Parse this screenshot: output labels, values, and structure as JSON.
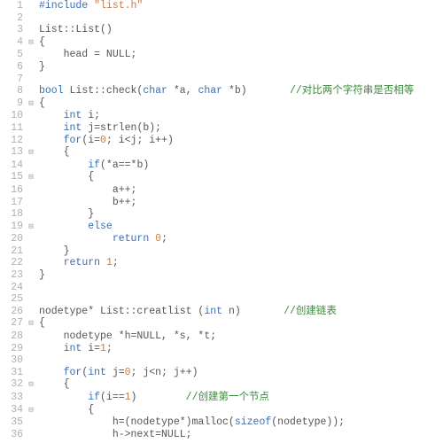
{
  "code": {
    "lines": [
      {
        "n": "1",
        "fold": "",
        "html": "<span class='kw'>#include</span> <span class='str'>\"list.h\"</span>"
      },
      {
        "n": "2",
        "fold": "",
        "html": ""
      },
      {
        "n": "3",
        "fold": "",
        "html": "List::List()"
      },
      {
        "n": "4",
        "fold": "⊟",
        "html": "{"
      },
      {
        "n": "5",
        "fold": "",
        "html": "    head = NULL;"
      },
      {
        "n": "6",
        "fold": "",
        "html": "}"
      },
      {
        "n": "7",
        "fold": "",
        "html": ""
      },
      {
        "n": "8",
        "fold": "",
        "html": "<span class='kw'>bool</span> List::check(<span class='kw'>char</span> *a, <span class='kw'>char</span> *b)       <span class='cmt'>//对比两个字符串是否相等</span>"
      },
      {
        "n": "9",
        "fold": "⊟",
        "html": "{"
      },
      {
        "n": "10",
        "fold": "",
        "html": "    <span class='kw'>int</span> i;"
      },
      {
        "n": "11",
        "fold": "",
        "html": "    <span class='kw'>int</span> j=strlen(b);"
      },
      {
        "n": "12",
        "fold": "",
        "html": "    <span class='kw'>for</span>(i=<span class='num'>0</span>; i&lt;j; i++)"
      },
      {
        "n": "13",
        "fold": "⊟",
        "html": "    {"
      },
      {
        "n": "14",
        "fold": "",
        "html": "        <span class='kw'>if</span>(*a==*b)"
      },
      {
        "n": "15",
        "fold": "⊟",
        "html": "        {"
      },
      {
        "n": "16",
        "fold": "",
        "html": "            a++;"
      },
      {
        "n": "17",
        "fold": "",
        "html": "            b++;"
      },
      {
        "n": "18",
        "fold": "",
        "html": "        }"
      },
      {
        "n": "19",
        "fold": "⊟",
        "html": "        <span class='kw'>else</span>"
      },
      {
        "n": "20",
        "fold": "",
        "html": "            <span class='kw'>return</span> <span class='num'>0</span>;"
      },
      {
        "n": "21",
        "fold": "",
        "html": "    }"
      },
      {
        "n": "22",
        "fold": "",
        "html": "    <span class='kw'>return</span> <span class='num'>1</span>;"
      },
      {
        "n": "23",
        "fold": "",
        "html": "}"
      },
      {
        "n": "24",
        "fold": "",
        "html": ""
      },
      {
        "n": "25",
        "fold": "",
        "html": ""
      },
      {
        "n": "26",
        "fold": "",
        "html": "nodetype* List::creatlist (<span class='kw'>int</span> n)       <span class='cmt'>//创建链表</span>"
      },
      {
        "n": "27",
        "fold": "⊟",
        "html": "{"
      },
      {
        "n": "28",
        "fold": "",
        "html": "    nodetype *h=NULL, *s, *t;"
      },
      {
        "n": "29",
        "fold": "",
        "html": "    <span class='kw'>int</span> i=<span class='num'>1</span>;"
      },
      {
        "n": "30",
        "fold": "",
        "html": ""
      },
      {
        "n": "31",
        "fold": "",
        "html": "    <span class='kw'>for</span>(<span class='kw'>int</span> j=<span class='num'>0</span>; j&lt;n; j++)"
      },
      {
        "n": "32",
        "fold": "⊟",
        "html": "    {"
      },
      {
        "n": "33",
        "fold": "",
        "html": "        <span class='kw'>if</span>(i==<span class='num'>1</span>)        <span class='cmt'>//创建第一个节点</span>"
      },
      {
        "n": "34",
        "fold": "⊟",
        "html": "        {"
      },
      {
        "n": "35",
        "fold": "",
        "html": "            h=(nodetype*)malloc(<span class='kw'>sizeof</span>(nodetype));"
      },
      {
        "n": "36",
        "fold": "",
        "html": "            h-&gt;next=NULL;"
      }
    ]
  }
}
